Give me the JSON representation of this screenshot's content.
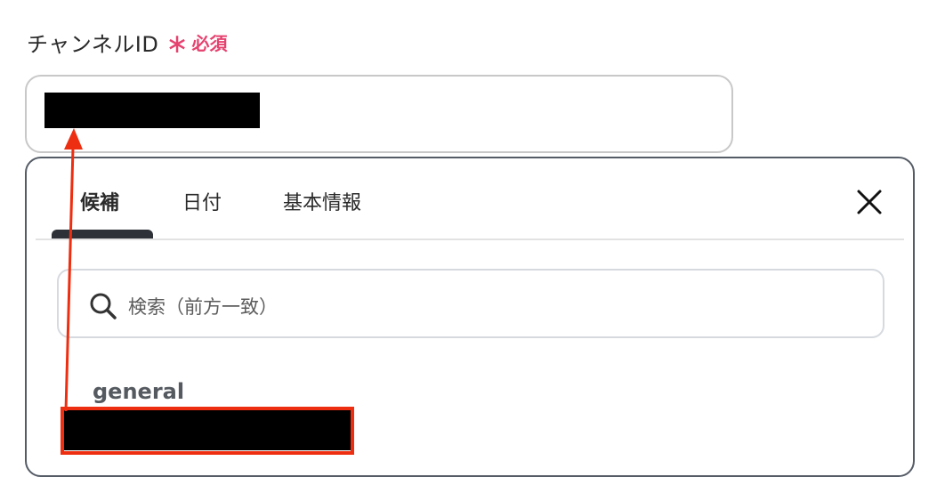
{
  "field": {
    "label": "チャンネルID",
    "required_star": "∗",
    "required_text": "必須"
  },
  "dropdown": {
    "tabs": [
      {
        "label": "候補",
        "active": true
      },
      {
        "label": "日付",
        "active": false
      },
      {
        "label": "基本情報",
        "active": false
      }
    ],
    "search": {
      "placeholder": "検索（前方一致）"
    },
    "items": [
      {
        "name": "general"
      }
    ]
  },
  "colors": {
    "required": "#e5426f",
    "annotation": "#ee2e10",
    "tab_underline": "#2e3238"
  },
  "icons": {
    "close": "close-icon",
    "search": "search-icon"
  }
}
